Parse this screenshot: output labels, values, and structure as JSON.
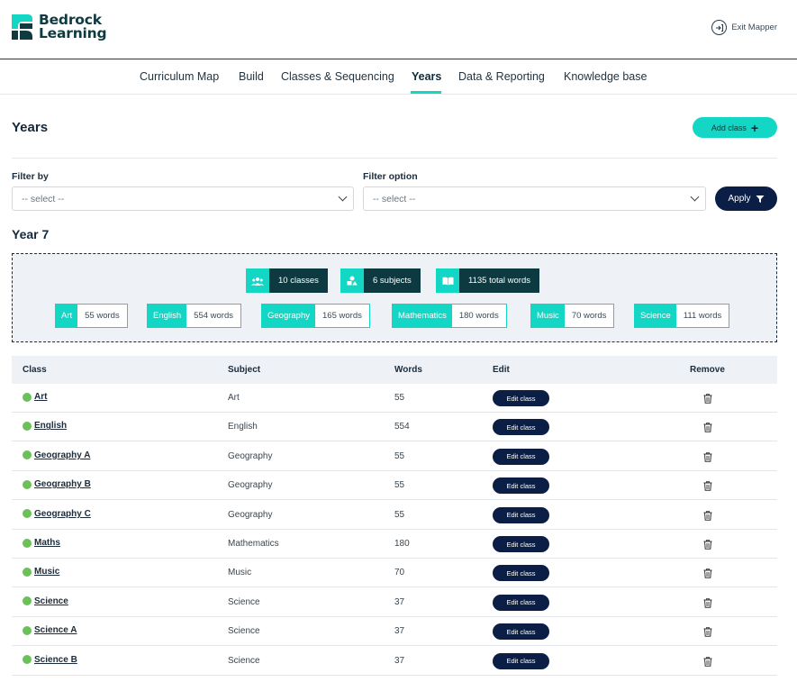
{
  "brand": {
    "line1": "Bedrock",
    "line2": "Learning",
    "accent": "#14d6c4",
    "dark": "#0b1e46"
  },
  "header": {
    "exit_label": "Exit Mapper"
  },
  "nav": [
    {
      "label": "Curriculum Map"
    },
    {
      "label": "Build"
    },
    {
      "label": "Classes & Sequencing"
    },
    {
      "label": "Years"
    },
    {
      "label": "Data & Reporting"
    },
    {
      "label": "Knowledge base"
    }
  ],
  "nav_active": "Years",
  "page": {
    "title": "Years",
    "add_class_label": "Add class"
  },
  "filters": {
    "filter_by_label": "Filter by",
    "filter_by_value": "-- select --",
    "filter_option_label": "Filter option",
    "filter_option_value": "-- select --",
    "apply_label": "Apply"
  },
  "year": {
    "title": "Year 7",
    "summary": [
      {
        "icon": "users-icon",
        "text": "10 classes"
      },
      {
        "icon": "shapes-icon",
        "text": "6 subjects"
      },
      {
        "icon": "book-icon",
        "text": "1135 total words"
      }
    ],
    "subjects": [
      {
        "name": "Art",
        "words": "55 words"
      },
      {
        "name": "English",
        "words": "554 words"
      },
      {
        "name": "Geography",
        "words": "165 words"
      },
      {
        "name": "Mathematics",
        "words": "180 words"
      },
      {
        "name": "Music",
        "words": "70 words"
      },
      {
        "name": "Science",
        "words": "111 words"
      }
    ]
  },
  "table": {
    "headers": {
      "class": "Class",
      "subject": "Subject",
      "words": "Words",
      "edit": "Edit",
      "remove": "Remove"
    },
    "edit_label": "Edit class",
    "rows": [
      {
        "class": "Art",
        "subject": "Art",
        "words": "55"
      },
      {
        "class": "English",
        "subject": "English",
        "words": "554"
      },
      {
        "class": "Geography A",
        "subject": "Geography",
        "words": "55"
      },
      {
        "class": "Geography B",
        "subject": "Geography",
        "words": "55"
      },
      {
        "class": "Geography C",
        "subject": "Geography",
        "words": "55"
      },
      {
        "class": "Maths",
        "subject": "Mathematics",
        "words": "180"
      },
      {
        "class": "Music",
        "subject": "Music",
        "words": "70"
      },
      {
        "class": "Science",
        "subject": "Science",
        "words": "37"
      },
      {
        "class": "Science A",
        "subject": "Science",
        "words": "37"
      },
      {
        "class": "Science B",
        "subject": "Science",
        "words": "37"
      }
    ]
  }
}
